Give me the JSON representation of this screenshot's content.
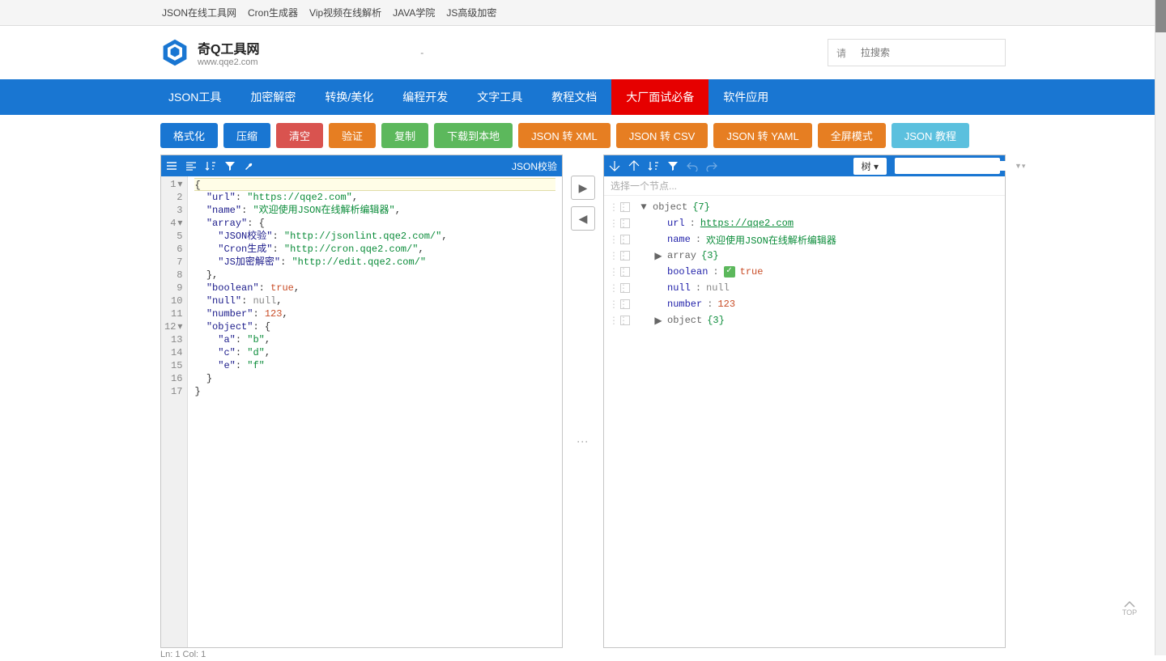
{
  "topLinks": [
    "JSON在线工具网",
    "Cron生成器",
    "Vip视频在线解析",
    "JAVA学院",
    "JS高级加密"
  ],
  "logo": {
    "title": "奇Q工具网",
    "sub": "www.qqe2.com"
  },
  "headerDash": "-",
  "search": {
    "label": "请",
    "placeholder": "拉搜索"
  },
  "nav": [
    {
      "label": "JSON工具",
      "highlight": false
    },
    {
      "label": "加密解密",
      "highlight": false
    },
    {
      "label": "转换/美化",
      "highlight": false
    },
    {
      "label": "编程开发",
      "highlight": false
    },
    {
      "label": "文字工具",
      "highlight": false
    },
    {
      "label": "教程文档",
      "highlight": false
    },
    {
      "label": "大厂面试必备",
      "highlight": true
    },
    {
      "label": "软件应用",
      "highlight": false
    }
  ],
  "toolbar": [
    {
      "label": "格式化",
      "cls": "btn-blue"
    },
    {
      "label": "压缩",
      "cls": "btn-blue"
    },
    {
      "label": "清空",
      "cls": "btn-red"
    },
    {
      "label": "验证",
      "cls": "btn-orange"
    },
    {
      "label": "复制",
      "cls": "btn-green"
    },
    {
      "label": "下载到本地",
      "cls": "btn-green"
    },
    {
      "label": "JSON 转 XML",
      "cls": "btn-orange"
    },
    {
      "label": "JSON 转 CSV",
      "cls": "btn-orange"
    },
    {
      "label": "JSON 转 YAML",
      "cls": "btn-orange"
    },
    {
      "label": "全屏模式",
      "cls": "btn-orange"
    },
    {
      "label": "JSON 教程",
      "cls": "btn-light"
    }
  ],
  "leftPanel": {
    "validateLabel": "JSON校验",
    "code": [
      {
        "n": "1",
        "fold": "▾",
        "hl": true,
        "tokens": [
          {
            "t": "{",
            "c": "punct"
          }
        ]
      },
      {
        "n": "2",
        "tokens": [
          {
            "t": "  ",
            "c": "ws"
          },
          {
            "t": "\"url\"",
            "c": "key"
          },
          {
            "t": ": ",
            "c": "punct"
          },
          {
            "t": "\"https://qqe2.com\"",
            "c": "str"
          },
          {
            "t": ",",
            "c": "punct"
          }
        ]
      },
      {
        "n": "3",
        "tokens": [
          {
            "t": "  ",
            "c": "ws"
          },
          {
            "t": "\"name\"",
            "c": "key"
          },
          {
            "t": ": ",
            "c": "punct"
          },
          {
            "t": "\"欢迎使用JSON在线解析编辑器\"",
            "c": "str"
          },
          {
            "t": ",",
            "c": "punct"
          }
        ]
      },
      {
        "n": "4",
        "fold": "▾",
        "tokens": [
          {
            "t": "  ",
            "c": "ws"
          },
          {
            "t": "\"array\"",
            "c": "key"
          },
          {
            "t": ": {",
            "c": "punct"
          }
        ]
      },
      {
        "n": "5",
        "tokens": [
          {
            "t": "    ",
            "c": "ws"
          },
          {
            "t": "\"JSON校验\"",
            "c": "key"
          },
          {
            "t": ": ",
            "c": "punct"
          },
          {
            "t": "\"http://jsonlint.qqe2.com/\"",
            "c": "str"
          },
          {
            "t": ",",
            "c": "punct"
          }
        ]
      },
      {
        "n": "6",
        "tokens": [
          {
            "t": "    ",
            "c": "ws"
          },
          {
            "t": "\"Cron生成\"",
            "c": "key"
          },
          {
            "t": ": ",
            "c": "punct"
          },
          {
            "t": "\"http://cron.qqe2.com/\"",
            "c": "str"
          },
          {
            "t": ",",
            "c": "punct"
          }
        ]
      },
      {
        "n": "7",
        "tokens": [
          {
            "t": "    ",
            "c": "ws"
          },
          {
            "t": "\"JS加密解密\"",
            "c": "key"
          },
          {
            "t": ": ",
            "c": "punct"
          },
          {
            "t": "\"http://edit.qqe2.com/\"",
            "c": "str"
          }
        ]
      },
      {
        "n": "8",
        "tokens": [
          {
            "t": "  },",
            "c": "punct"
          }
        ]
      },
      {
        "n": "9",
        "tokens": [
          {
            "t": "  ",
            "c": "ws"
          },
          {
            "t": "\"boolean\"",
            "c": "key"
          },
          {
            "t": ": ",
            "c": "punct"
          },
          {
            "t": "true",
            "c": "bool"
          },
          {
            "t": ",",
            "c": "punct"
          }
        ]
      },
      {
        "n": "10",
        "tokens": [
          {
            "t": "  ",
            "c": "ws"
          },
          {
            "t": "\"null\"",
            "c": "key"
          },
          {
            "t": ": ",
            "c": "punct"
          },
          {
            "t": "null",
            "c": "null"
          },
          {
            "t": ",",
            "c": "punct"
          }
        ]
      },
      {
        "n": "11",
        "tokens": [
          {
            "t": "  ",
            "c": "ws"
          },
          {
            "t": "\"number\"",
            "c": "key"
          },
          {
            "t": ": ",
            "c": "punct"
          },
          {
            "t": "123",
            "c": "num"
          },
          {
            "t": ",",
            "c": "punct"
          }
        ]
      },
      {
        "n": "12",
        "fold": "▾",
        "tokens": [
          {
            "t": "  ",
            "c": "ws"
          },
          {
            "t": "\"object\"",
            "c": "key"
          },
          {
            "t": ": {",
            "c": "punct"
          }
        ]
      },
      {
        "n": "13",
        "tokens": [
          {
            "t": "    ",
            "c": "ws"
          },
          {
            "t": "\"a\"",
            "c": "key"
          },
          {
            "t": ": ",
            "c": "punct"
          },
          {
            "t": "\"b\"",
            "c": "str"
          },
          {
            "t": ",",
            "c": "punct"
          }
        ]
      },
      {
        "n": "14",
        "tokens": [
          {
            "t": "    ",
            "c": "ws"
          },
          {
            "t": "\"c\"",
            "c": "key"
          },
          {
            "t": ": ",
            "c": "punct"
          },
          {
            "t": "\"d\"",
            "c": "str"
          },
          {
            "t": ",",
            "c": "punct"
          }
        ]
      },
      {
        "n": "15",
        "tokens": [
          {
            "t": "    ",
            "c": "ws"
          },
          {
            "t": "\"e\"",
            "c": "key"
          },
          {
            "t": ": ",
            "c": "punct"
          },
          {
            "t": "\"f\"",
            "c": "str"
          }
        ]
      },
      {
        "n": "16",
        "tokens": [
          {
            "t": "  }",
            "c": "punct"
          }
        ]
      },
      {
        "n": "17",
        "tokens": [
          {
            "t": "}",
            "c": "punct"
          }
        ]
      }
    ]
  },
  "rightPanel": {
    "dropdown": "树",
    "hint": "选择一个节点...",
    "rows": [
      {
        "indent": 0,
        "exp": "▼",
        "key": "object",
        "count": "{7}"
      },
      {
        "indent": 1,
        "key": "url",
        "sep": ":",
        "url": "https://qqe2.com"
      },
      {
        "indent": 1,
        "key": "name",
        "sep": ":",
        "str": "欢迎使用JSON在线解析编辑器"
      },
      {
        "indent": 1,
        "exp": "▶",
        "key": "array",
        "count": "{3}"
      },
      {
        "indent": 1,
        "key": "boolean",
        "sep": ":",
        "bool": "true"
      },
      {
        "indent": 1,
        "key": "null",
        "sep": ":",
        "nullv": "null"
      },
      {
        "indent": 1,
        "key": "number",
        "sep": ":",
        "num": "123"
      },
      {
        "indent": 1,
        "exp": "▶",
        "key": "object",
        "count": "{3}"
      }
    ]
  },
  "status": "Ln: 1   Col: 1",
  "toTop": "TOP"
}
